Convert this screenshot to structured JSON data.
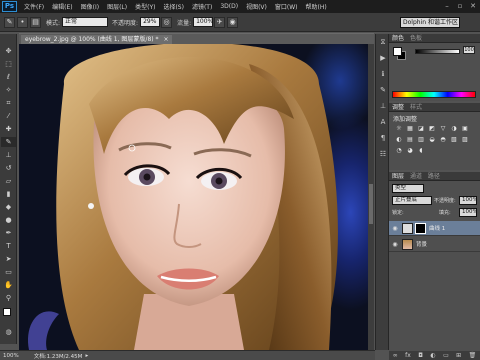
{
  "app": {
    "logo": "Ps",
    "menu": [
      "文件(F)",
      "编辑(E)",
      "图像(I)",
      "图层(L)",
      "类型(Y)",
      "选择(S)",
      "滤镜(T)",
      "3D(D)",
      "视图(V)",
      "窗口(W)",
      "帮助(H)"
    ],
    "window_buttons": [
      "–",
      "▫",
      "✕"
    ]
  },
  "options": {
    "mode_label": "模式:",
    "mode_value": "正常",
    "opacity_label": "不透明度:",
    "opacity_value": "29%",
    "flow_label": "流量:",
    "flow_value": "100%",
    "workspace": "Dolphin 和谐工作区"
  },
  "document": {
    "tab_title": "eyebrow_2.jpg @ 100% (曲线 1, 图层蒙版/8) *",
    "tab_close": "×"
  },
  "status": {
    "zoom": "100%",
    "doc_info": "文档:1.23M/2.45M"
  },
  "panels": {
    "color": {
      "tab1": "颜色",
      "tab2": "色板",
      "value": "100"
    },
    "adjustments": {
      "tab1": "调整",
      "tab2": "样式",
      "subtitle": "添加调整",
      "icons": [
        "☼",
        "▦",
        "◪",
        "◩",
        "▽",
        "◑",
        "▣",
        "◐",
        "▤",
        "▥",
        "◒",
        "◓",
        "▧",
        "▨",
        "◔",
        "◕",
        "◖"
      ]
    },
    "layers": {
      "tab1": "图层",
      "tab2": "通道",
      "tab3": "路径",
      "kind": "类型",
      "blend": "正片叠底",
      "opacity_label": "不透明度:",
      "opacity_value": "100%",
      "lock_label": "锁定:",
      "fill_label": "填充:",
      "fill_value": "100%",
      "layers": [
        {
          "name": "曲线 1",
          "selected": true
        },
        {
          "name": "背景",
          "selected": false
        }
      ]
    }
  }
}
